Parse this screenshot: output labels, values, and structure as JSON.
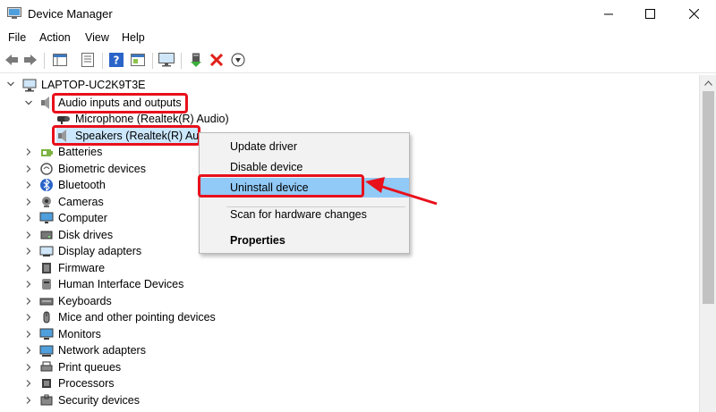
{
  "window": {
    "title": "Device Manager",
    "controls": {
      "minimize": "–",
      "maximize": "☐",
      "close": "✕"
    }
  },
  "menu": [
    "File",
    "Action",
    "View",
    "Help"
  ],
  "toolbar_icons": [
    "back-icon",
    "forward-icon",
    "properties-grid-icon",
    "list-icon",
    "help-icon",
    "scan-icon",
    "monitor-icon",
    "add-driver-icon",
    "uninstall-icon",
    "update-driver-icon"
  ],
  "tree": {
    "root": "LAPTOP-UC2K9T3E",
    "expanded_category": "Audio inputs and outputs",
    "children": [
      "Microphone (Realtek(R) Audio)",
      "Speakers (Realtek(R) Audio)"
    ],
    "categories": [
      "Batteries",
      "Biometric devices",
      "Bluetooth",
      "Cameras",
      "Computer",
      "Disk drives",
      "Display adapters",
      "Firmware",
      "Human Interface Devices",
      "Keyboards",
      "Mice and other pointing devices",
      "Monitors",
      "Network adapters",
      "Print queues",
      "Processors",
      "Security devices"
    ]
  },
  "context_menu": {
    "items": [
      "Update driver",
      "Disable device",
      "Uninstall device",
      "Scan for hardware changes",
      "Properties"
    ],
    "highlighted": "Uninstall device"
  },
  "colors": {
    "annotation": "#e8101b",
    "highlight": "#91c9f7",
    "selection": "#cce8ff"
  }
}
